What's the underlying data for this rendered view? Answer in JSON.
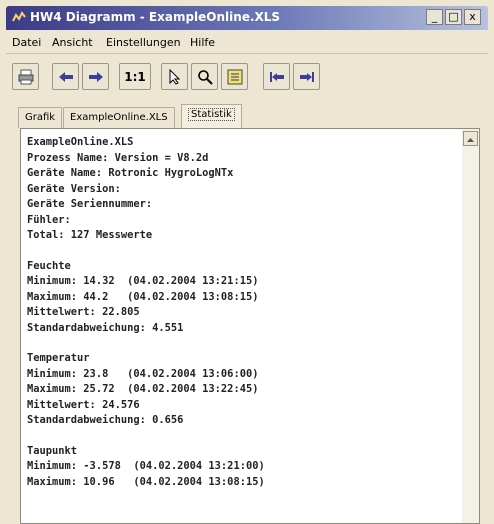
{
  "window": {
    "title": "HW4 Diagramm - ExampleOnline.XLS",
    "min_label": "_",
    "max_label": "□",
    "close_label": "x"
  },
  "menu": {
    "items": [
      "Datei",
      "Ansicht",
      "Einstellungen",
      "Hilfe"
    ]
  },
  "toolbar": {
    "zoom_label": "1:1",
    "icons": [
      "print-icon",
      "arrow-left-icon",
      "arrow-right-icon",
      "zoom-1-1",
      "pointer-icon",
      "magnifier-icon",
      "legend-icon",
      "jump-start-icon",
      "jump-end-icon"
    ]
  },
  "tabs": {
    "items": [
      "Grafik",
      "ExampleOnline.XLS",
      "Statistik"
    ],
    "active": "Statistik"
  },
  "stats": {
    "lines_header": [
      "ExampleOnline.XLS",
      "Prozess Name: Version = V8.2d",
      "Geräte Name: Rotronic HygroLogNTx",
      "Geräte Version:",
      "Geräte Seriennummer:",
      "Fühler:",
      "Total: 127 Messwerte"
    ],
    "feuchte": [
      "Feuchte",
      "Minimum: 14.32  (04.02.2004 13:21:15)",
      "Maximum: 44.2   (04.02.2004 13:08:15)",
      "Mittelwert: 22.805",
      "Standardabweichung: 4.551"
    ],
    "temperatur": [
      "Temperatur",
      "Minimum: 23.8   (04.02.2004 13:06:00)",
      "Maximum: 25.72  (04.02.2004 13:22:45)",
      "Mittelwert: 24.576",
      "Standardabweichung: 0.656"
    ],
    "taupunkt": [
      "Taupunkt",
      "Minimum: -3.578  (04.02.2004 13:21:00)",
      "Maximum: 10.96   (04.02.2004 13:08:15)"
    ]
  },
  "colors": {
    "title_start": "#3b3a86",
    "title_end": "#b7c2de",
    "text": "#222222"
  }
}
